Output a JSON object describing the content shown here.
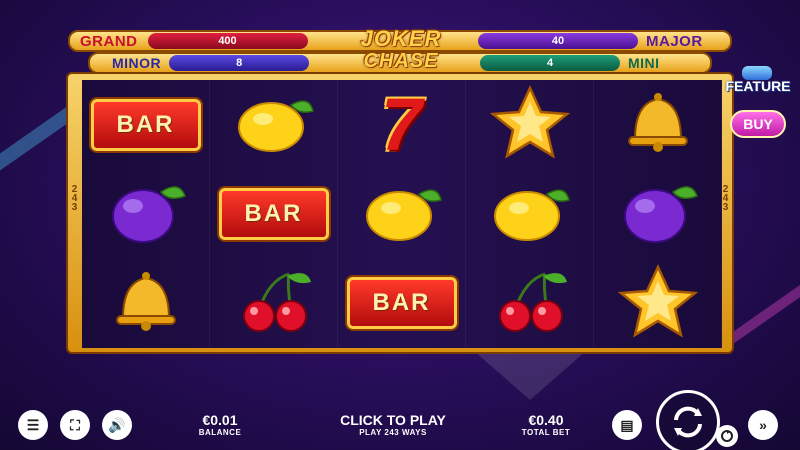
{
  "jackpots": {
    "grand": {
      "label": "GRAND",
      "value": "400"
    },
    "major": {
      "label": "MAJOR",
      "value": "40"
    },
    "minor": {
      "label": "MINOR",
      "value": "8"
    },
    "mini": {
      "label": "MINI",
      "value": "4"
    }
  },
  "logo": {
    "line1": "JOKER",
    "line2": "CHASE"
  },
  "reels": {
    "ways_left": "243",
    "ways_right": "243",
    "grid": [
      [
        "bar",
        "lemon",
        "seven",
        "star",
        "bell"
      ],
      [
        "plum",
        "bar",
        "lemon",
        "lemon",
        "plum"
      ],
      [
        "bell",
        "cherry",
        "bar",
        "cherry",
        "star"
      ]
    ],
    "bar_text": "BAR",
    "seven_text": "7"
  },
  "feature": {
    "label": "FEATURE",
    "buy_label": "BUY"
  },
  "bottom": {
    "balance_value": "€0.01",
    "balance_label": "BALANCE",
    "play_main": "CLICK TO PLAY",
    "play_sub": "PLAY 243 WAYS",
    "total_bet_value": "€0.40",
    "total_bet_label": "TOTAL BET"
  },
  "colors": {
    "accent_gold": "#ffd24a",
    "grand_bar": "#c8102e",
    "major_bar": "#6a1fd0",
    "minor_bar": "#3a2fd0",
    "mini_bar": "#0f7a5a"
  }
}
